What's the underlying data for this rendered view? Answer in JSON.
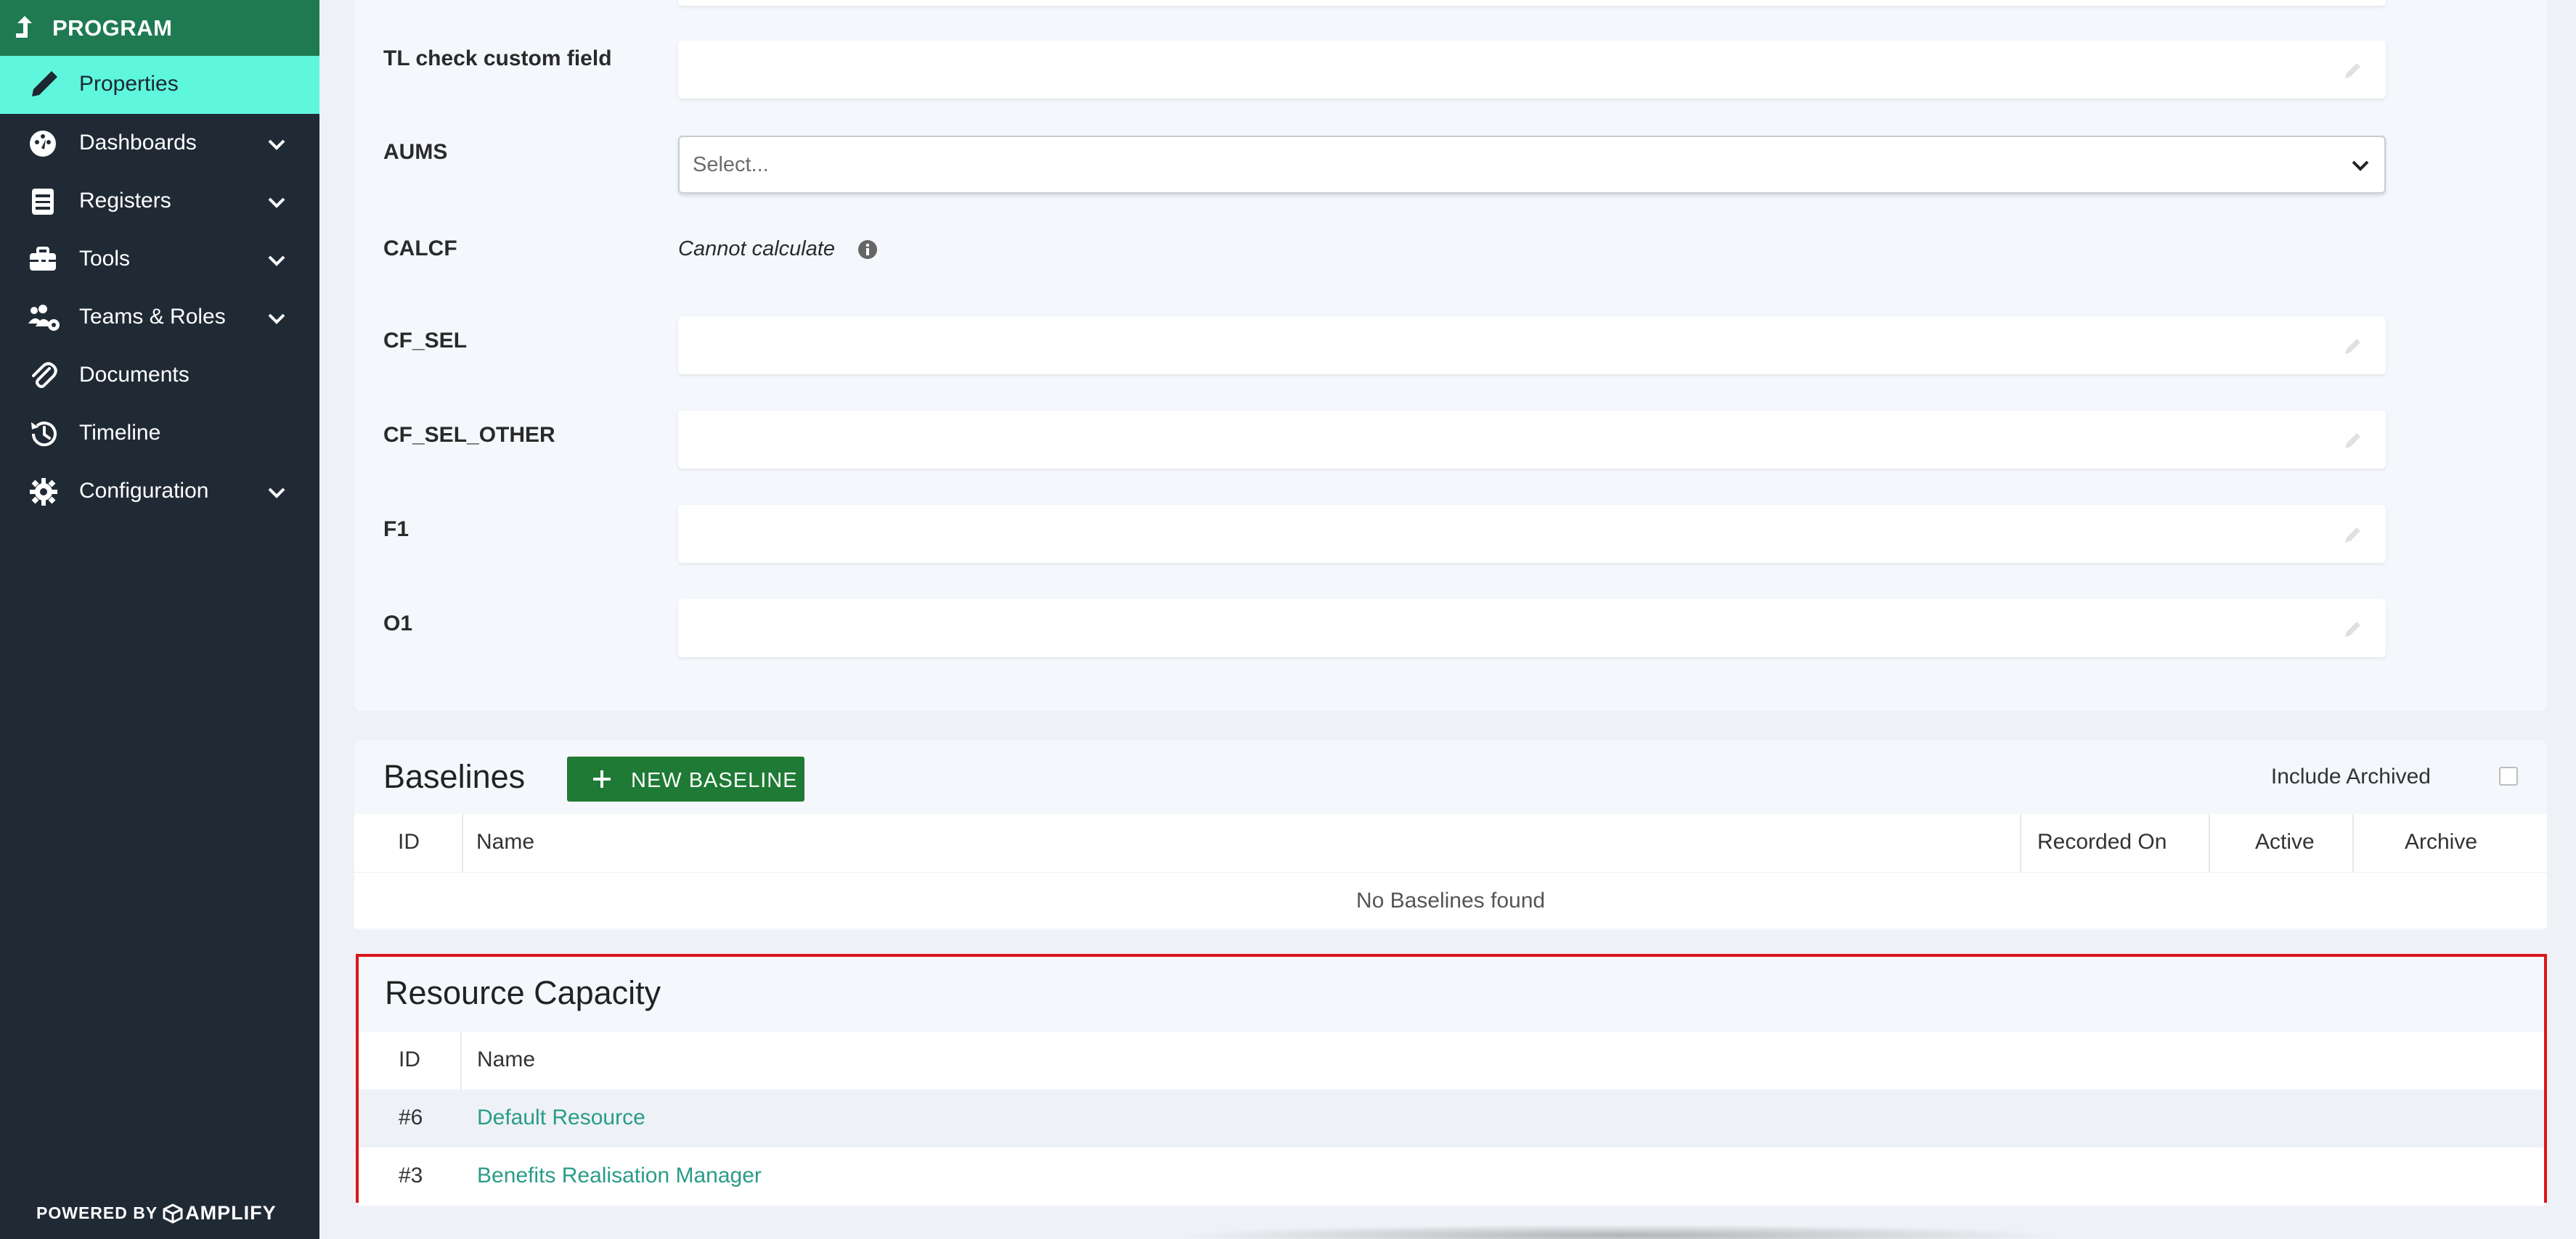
{
  "sidebar": {
    "program_title": "PROGRAM",
    "items": [
      {
        "label": "Properties",
        "icon": "pencil-icon",
        "active": true,
        "expandable": false
      },
      {
        "label": "Dashboards",
        "icon": "dashboard-gauge-icon",
        "active": false,
        "expandable": true
      },
      {
        "label": "Registers",
        "icon": "register-list-icon",
        "active": false,
        "expandable": true
      },
      {
        "label": "Tools",
        "icon": "toolbox-icon",
        "active": false,
        "expandable": true
      },
      {
        "label": "Teams & Roles",
        "icon": "users-gear-icon",
        "active": false,
        "expandable": true
      },
      {
        "label": "Documents",
        "icon": "paperclip-icon",
        "active": false,
        "expandable": false
      },
      {
        "label": "Timeline",
        "icon": "history-icon",
        "active": false,
        "expandable": false
      },
      {
        "label": "Configuration",
        "icon": "gear-icon",
        "active": false,
        "expandable": true
      }
    ],
    "powered_by": "POWERED BY",
    "brand": "AMPLIFY"
  },
  "properties": {
    "fields": [
      {
        "label": "TL check custom field",
        "type": "text",
        "value": ""
      },
      {
        "label": "AUMS",
        "type": "select",
        "placeholder": "Select..."
      },
      {
        "label": "CALCF",
        "type": "calculated",
        "value": "Cannot calculate"
      },
      {
        "label": "CF_SEL",
        "type": "text",
        "value": ""
      },
      {
        "label": "CF_SEL_OTHER",
        "type": "text",
        "value": ""
      },
      {
        "label": "F1",
        "type": "text",
        "value": ""
      },
      {
        "label": "O1",
        "type": "text",
        "value": ""
      }
    ]
  },
  "baselines": {
    "title": "Baselines",
    "new_button": "NEW BASELINE",
    "include_archived": "Include Archived",
    "include_archived_checked": false,
    "columns": [
      "ID",
      "Name",
      "Recorded On",
      "Active",
      "Archive"
    ],
    "empty_message": "No Baselines found"
  },
  "resource_capacity": {
    "title": "Resource Capacity",
    "columns": [
      "ID",
      "Name"
    ],
    "rows": [
      {
        "id": "#6",
        "name": "Default Resource"
      },
      {
        "id": "#3",
        "name": "Benefits Realisation Manager"
      }
    ]
  },
  "colors": {
    "sidebar_bg": "#1f2a35",
    "program_header": "#1f7a52",
    "active_item": "#5ef7dd",
    "primary_button": "#1e7a34",
    "link": "#2a9c87",
    "highlight_border": "#d9161b"
  }
}
